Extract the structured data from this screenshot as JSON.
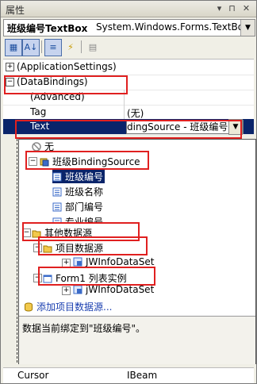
{
  "window": {
    "title": "属性"
  },
  "object_selector": {
    "name": "班级编号TextBox",
    "type": "System.Windows.Forms.TextBox"
  },
  "grid": {
    "app_settings": "(ApplicationSettings)",
    "data_bindings": "(DataBindings)",
    "advanced": "(Advanced)",
    "tag_label": "Tag",
    "tag_value": "(无)",
    "text_label": "Text",
    "text_value": "dingSource - 班级编号",
    "cursor_label": "Cursor",
    "cursor_value": "IBeam"
  },
  "tree": {
    "none": "无",
    "binding_source": "班级BindingSource",
    "fields": [
      "班级编号",
      "班级名称",
      "部门编号",
      "专业编号"
    ],
    "other_sources": "其他数据源",
    "project_sources": "项目数据源",
    "project_dataset": "JWInfoDataSet",
    "form_instances": "Form1 列表实例",
    "form_dataset": "jWInfoDataSet"
  },
  "add_link": "添加项目数据源...",
  "description": "数据当前绑定到\"班级编号\"。",
  "colors": {
    "selection": "#0a246a",
    "highlight_box": "#e02020",
    "link": "#1a3fb0"
  }
}
